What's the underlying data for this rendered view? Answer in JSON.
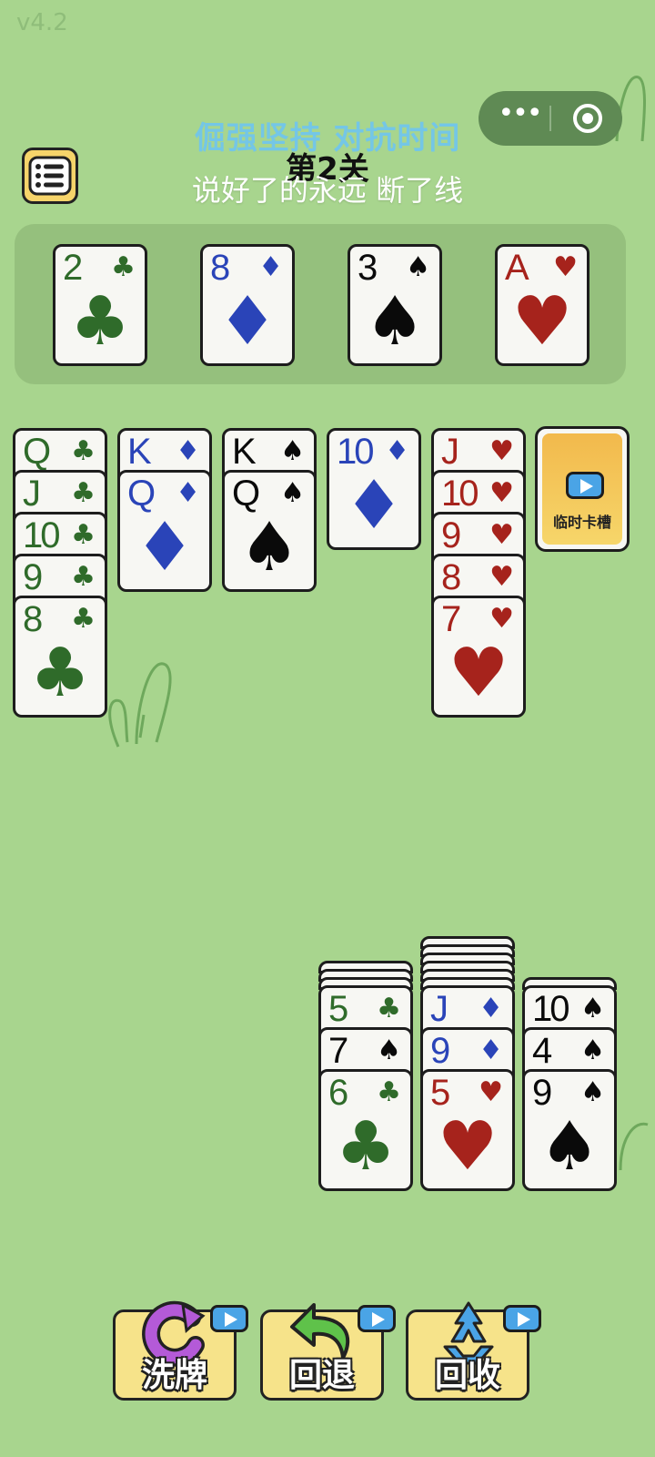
{
  "version": "v4.2",
  "header": {
    "tagline": "倔强坚持 对抗时间",
    "level": "第2关",
    "subtitle": "说好了的永远 断了线"
  },
  "colors": {
    "background": "#a8d58e",
    "club": "#2f6b2a",
    "diamond": "#2a44b8",
    "spade": "#0a0a0a",
    "heart": "#a6231c"
  },
  "icons": {
    "menu": "list-menu-icon",
    "more": "more-dots-icon",
    "close": "target-icon",
    "shuffle": "shuffle-icon",
    "undo": "undo-arrow-icon",
    "recycle": "recycle-icon",
    "video": "play-video-icon"
  },
  "foundation": [
    {
      "rank": "2",
      "suit": "♣"
    },
    {
      "rank": "8",
      "suit": "♦"
    },
    {
      "rank": "3",
      "suit": "♠"
    },
    {
      "rank": "A",
      "suit": "♥"
    }
  ],
  "tableau": [
    [
      {
        "rank": "Q",
        "suit": "♣"
      },
      {
        "rank": "J",
        "suit": "♣"
      },
      {
        "rank": "10",
        "suit": "♣"
      },
      {
        "rank": "9",
        "suit": "♣"
      },
      {
        "rank": "8",
        "suit": "♣"
      }
    ],
    [
      {
        "rank": "K",
        "suit": "♦"
      },
      {
        "rank": "Q",
        "suit": "♦"
      }
    ],
    [
      {
        "rank": "K",
        "suit": "♠"
      },
      {
        "rank": "Q",
        "suit": "♠"
      }
    ],
    [
      {
        "rank": "10",
        "suit": "♦"
      }
    ],
    [
      {
        "rank": "J",
        "suit": "♥"
      },
      {
        "rank": "10",
        "suit": "♥"
      },
      {
        "rank": "9",
        "suit": "♥"
      },
      {
        "rank": "8",
        "suit": "♥"
      },
      {
        "rank": "7",
        "suit": "♥"
      }
    ]
  ],
  "temp_slot": {
    "label": "临时卡槽"
  },
  "draw_piles": [
    {
      "hidden": 3,
      "cards": [
        {
          "rank": "5",
          "suit": "♣"
        },
        {
          "rank": "7",
          "suit": "♠"
        },
        {
          "rank": "6",
          "suit": "♣"
        }
      ]
    },
    {
      "hidden": 6,
      "cards": [
        {
          "rank": "J",
          "suit": "♦"
        },
        {
          "rank": "9",
          "suit": "♦"
        },
        {
          "rank": "5",
          "suit": "♥"
        }
      ]
    },
    {
      "hidden": 1,
      "cards": [
        {
          "rank": "10",
          "suit": "♠"
        },
        {
          "rank": "4",
          "suit": "♠"
        },
        {
          "rank": "9",
          "suit": "♠"
        }
      ]
    }
  ],
  "tools": {
    "shuffle": "洗牌",
    "undo": "回退",
    "recycle": "回收"
  }
}
